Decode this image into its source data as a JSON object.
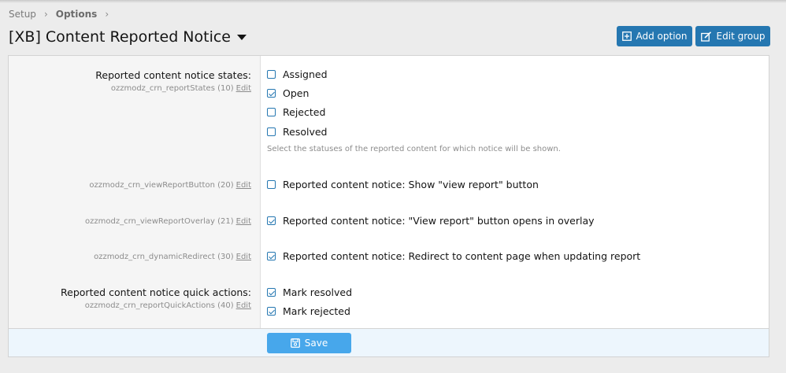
{
  "breadcrumb": {
    "setup": "Setup",
    "options": "Options"
  },
  "header": {
    "title": "[XB] Content Reported Notice"
  },
  "toolbar": {
    "add_option": "Add option",
    "edit_group": "Edit group"
  },
  "options": {
    "report_states": {
      "label": "Reported content notice states:",
      "meta": "ozzmodz_crn_reportStates (10)",
      "edit": "Edit",
      "items": [
        {
          "label": "Assigned",
          "checked": false
        },
        {
          "label": "Open",
          "checked": true
        },
        {
          "label": "Rejected",
          "checked": false
        },
        {
          "label": "Resolved",
          "checked": false
        }
      ],
      "hint": "Select the statuses of the reported content for which notice will be shown."
    },
    "view_report_button": {
      "meta": "ozzmodz_crn_viewReportButton (20)",
      "edit": "Edit",
      "label": "Reported content notice: Show \"view report\" button",
      "checked": false
    },
    "view_report_overlay": {
      "meta": "ozzmodz_crn_viewReportOverlay (21)",
      "edit": "Edit",
      "label": "Reported content notice: \"View report\" button opens in overlay",
      "checked": true
    },
    "dynamic_redirect": {
      "meta": "ozzmodz_crn_dynamicRedirect (30)",
      "edit": "Edit",
      "label": "Reported content notice: Redirect to content page when updating report",
      "checked": true
    },
    "quick_actions": {
      "label": "Reported content notice quick actions:",
      "meta": "ozzmodz_crn_reportQuickActions (40)",
      "edit": "Edit",
      "items": [
        {
          "label": "Mark resolved",
          "checked": true
        },
        {
          "label": "Mark rejected",
          "checked": true
        }
      ]
    }
  },
  "footer": {
    "save_label": "Save"
  },
  "colors": {
    "primary": "#2577b1",
    "save": "#47a7eb",
    "footer_bg": "#edf6fd"
  }
}
